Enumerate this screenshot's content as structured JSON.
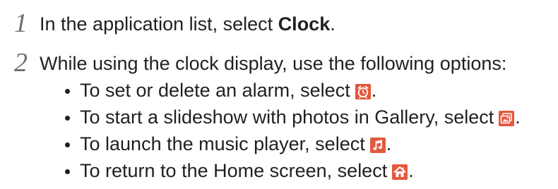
{
  "steps": [
    {
      "number": "1",
      "text_before": "In the application list, select ",
      "text_bold": "Clock",
      "text_after": "."
    },
    {
      "number": "2",
      "text": "While using the clock display, use the following options:"
    }
  ],
  "bullets": [
    {
      "text": "To set or delete an alarm, select",
      "icon": "alarm-clock-icon",
      "after": "."
    },
    {
      "text": "To start a slideshow with photos in Gallery, select",
      "icon": "gallery-slideshow-icon",
      "after": "."
    },
    {
      "text": "To launch the music player, select",
      "icon": "music-note-icon",
      "after": "."
    },
    {
      "text": "To return to the Home screen, select",
      "icon": "home-icon",
      "after": "."
    }
  ],
  "colors": {
    "text": "#231f20",
    "step_number": "#6d6e71",
    "icon_alarm": "#e2563b",
    "icon_gallery": "#e8573d",
    "icon_music": "#e25a3e",
    "icon_home": "#e5583c"
  }
}
